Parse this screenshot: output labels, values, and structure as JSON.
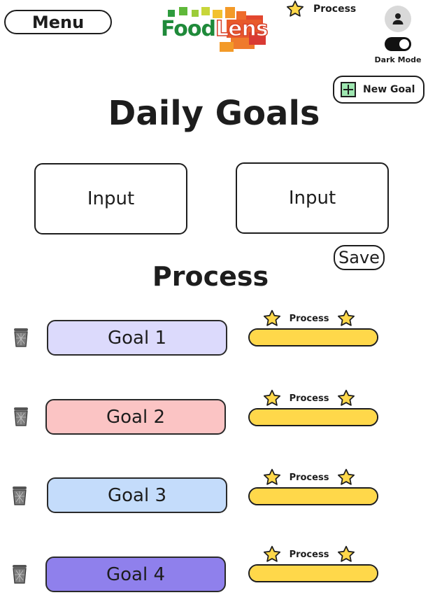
{
  "header": {
    "menu_label": "Menu",
    "logo": {
      "food": "Food",
      "lens": "Lens"
    },
    "top_progress_label": "Process",
    "dark_mode_label": "Dark Mode",
    "dark_mode_on": true,
    "new_goal_label": "New Goal"
  },
  "page_title": "Daily Goals",
  "inputs": [
    {
      "value": "Input"
    },
    {
      "value": "Input"
    }
  ],
  "save_label": "Save",
  "section_title": "Process",
  "goals": [
    {
      "label": "Goal 1",
      "color": "#dcdafc",
      "progress_label": "Process",
      "progress": 1.0
    },
    {
      "label": "Goal 2",
      "color": "#fbc4c4",
      "progress_label": "Process",
      "progress": 1.0
    },
    {
      "label": "Goal 3",
      "color": "#c4dcfb",
      "progress_label": "Process",
      "progress": 1.0
    },
    {
      "label": "Goal 4",
      "color": "#8f80ec",
      "progress_label": "Process",
      "progress": 1.0
    }
  ],
  "colors": {
    "star_fill": "#ffd84a",
    "progress_fill": "#ffd84a",
    "new_goal_plus": "#9ee6b0"
  },
  "icons": {
    "star": "star-icon",
    "trash": "trash-icon",
    "user": "user-icon",
    "plus": "plus-icon"
  }
}
